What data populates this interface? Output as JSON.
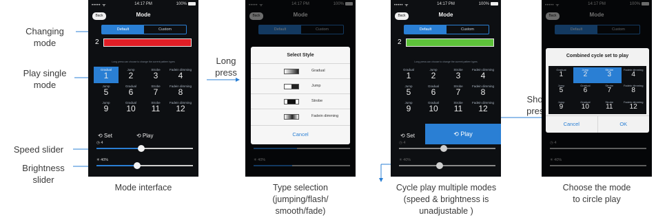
{
  "status": {
    "signal": "••••• ᯤ",
    "time": "14:17 PM",
    "battery": "100%"
  },
  "nav": {
    "back": "Back",
    "title": "Mode"
  },
  "segment": {
    "default": "Default",
    "custom": "Custom"
  },
  "color_row": {
    "number": "2",
    "red": "#e11e26",
    "green": "#5dc23a"
  },
  "hint_text": "Long press can choose to change the current pattern types",
  "modes": [
    {
      "type": "Gradual",
      "num": "1"
    },
    {
      "type": "Jump",
      "num": "2"
    },
    {
      "type": "Strobe",
      "num": "3"
    },
    {
      "type": "Fadein dimming",
      "num": "4"
    },
    {
      "type": "Jump",
      "num": "5"
    },
    {
      "type": "Gradual",
      "num": "6"
    },
    {
      "type": "Strobe",
      "num": "7"
    },
    {
      "type": "Fadein dimming",
      "num": "8"
    },
    {
      "type": "Jump",
      "num": "9"
    },
    {
      "type": "Gradual",
      "num": "10"
    },
    {
      "type": "Strobe",
      "num": "11"
    },
    {
      "type": "Fadein dimming",
      "num": "12"
    }
  ],
  "controls": {
    "set": "⟲ Set",
    "play": "⟲ Play"
  },
  "speed_label": "◷ 4",
  "brightness_label": "✳ 40%",
  "style_modal": {
    "title": "Select Style",
    "options": [
      "Gradual",
      "Jump",
      "Strobe",
      "Fadein dimming"
    ],
    "cancel": "Cancel"
  },
  "cycle_modal": {
    "title": "Combined cycle set to play",
    "cancel": "Cancel",
    "ok": "OK"
  },
  "annotations": {
    "changing_mode_1": "Changing",
    "changing_mode_2": "mode",
    "play_single_1": "Play single",
    "play_single_2": "mode",
    "speed_slider": "Speed slider",
    "brightness_1": "Brightness",
    "brightness_2": "slider",
    "long_press_1": "Long",
    "long_press_2": "press",
    "short_press_1": "Short",
    "short_press_2": "press"
  },
  "captions": {
    "mode_interface": "Mode interface",
    "type_selection_1": "Type selection",
    "type_selection_2": "(jumping/flash/",
    "type_selection_3": "smooth/fade)",
    "cycle_1": "Cycle play multiple modes",
    "cycle_2": "(speed & brightness is",
    "cycle_3": "unadjustable )",
    "choose_1": "Choose the mode",
    "choose_2": "to circle play"
  },
  "colors": {
    "accent": "#2a7fd4",
    "screen_bg": "#0d0f12"
  },
  "speed_value": 0.45,
  "brightness_value": 0.4
}
